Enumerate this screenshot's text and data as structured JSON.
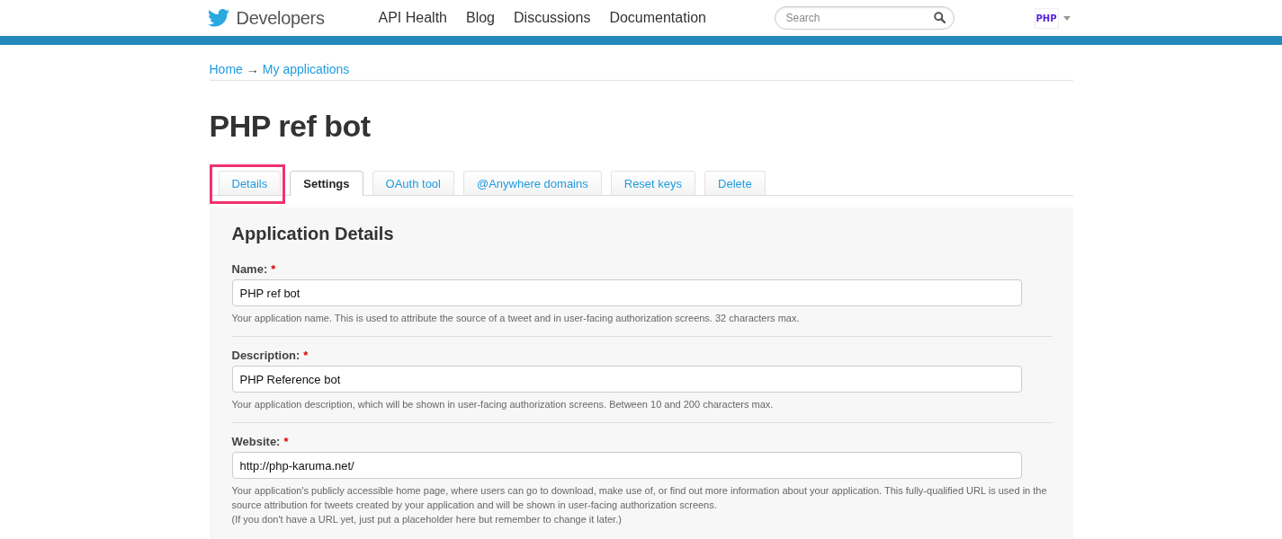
{
  "header": {
    "logo_text": "Developers",
    "nav": [
      "API Health",
      "Blog",
      "Discussions",
      "Documentation"
    ],
    "search": {
      "placeholder": "Search"
    },
    "user_badge": "PHP"
  },
  "breadcrumb": {
    "items": [
      "Home",
      "My applications"
    ],
    "separator": "→"
  },
  "title": "PHP ref bot",
  "tabs": [
    {
      "label": "Details",
      "selected": false,
      "highlighted": true
    },
    {
      "label": "Settings",
      "selected": true,
      "highlighted": false
    },
    {
      "label": "OAuth tool",
      "selected": false,
      "highlighted": false
    },
    {
      "label": "@Anywhere domains",
      "selected": false,
      "highlighted": false
    },
    {
      "label": "Reset keys",
      "selected": false,
      "highlighted": false
    },
    {
      "label": "Delete",
      "selected": false,
      "highlighted": false
    }
  ],
  "section": {
    "heading": "Application Details",
    "fields": [
      {
        "label": "Name:",
        "required": true,
        "value": "PHP ref bot",
        "help": [
          "Your application name. This is used to attribute the source of a tweet and in user-facing authorization screens. 32 characters max."
        ]
      },
      {
        "label": "Description:",
        "required": true,
        "value": "PHP Reference bot",
        "help": [
          "Your application description, which will be shown in user-facing authorization screens. Between 10 and 200 characters max."
        ]
      },
      {
        "label": "Website:",
        "required": true,
        "value": "http://php-karuma.net/",
        "help": [
          "Your application's publicly accessible home page, where users can go to download, make use of, or find out more information about your application. This fully-qualified URL is used in the source attribution for tweets created by your application and will be shown in user-facing authorization screens.",
          "(If you don't have a URL yet, just put a placeholder here but remember to change it later.)"
        ]
      }
    ],
    "required_mark": "*"
  }
}
